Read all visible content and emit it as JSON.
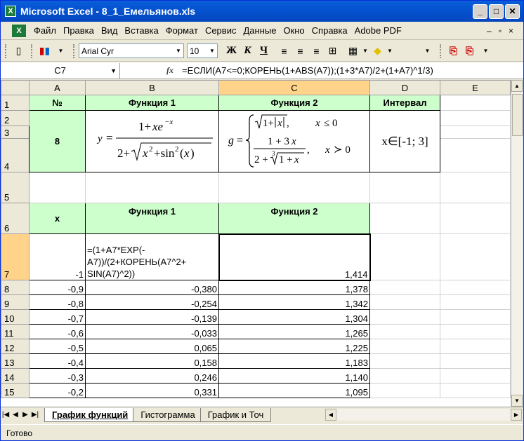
{
  "window": {
    "title": "Microsoft Excel - 8_1_Емельянов.xls",
    "app_icon_text": "X"
  },
  "window_buttons": {
    "minimize": "_",
    "maximize": "□",
    "close": "✕"
  },
  "menu": {
    "items": [
      "Файл",
      "Правка",
      "Вид",
      "Вставка",
      "Формат",
      "Сервис",
      "Данные",
      "Окно",
      "Справка",
      "Adobe PDF"
    ],
    "right": [
      "–",
      "▫",
      "×"
    ]
  },
  "toolbar": {
    "font_name": "Arial Cyr",
    "font_size": "10",
    "bold": "Ж",
    "italic": "К",
    "underline": "Ч"
  },
  "formula_bar": {
    "name_box": "C7",
    "fx": "fx",
    "formula": "=ЕСЛИ(A7<=0;КОРЕНЬ(1+ABS(A7));(1+3*A7)/2+(1+A7)^1/3)"
  },
  "columns": [
    "A",
    "B",
    "C",
    "D",
    "E"
  ],
  "selected_column": "C",
  "selected_row": "7",
  "header_cells": {
    "num": "№",
    "func1": "Функция 1",
    "func2": "Функция 2",
    "interval": "Интервал",
    "variant": "8",
    "interval_value": "x∈[-1; 3]",
    "x_label": "x",
    "func1_b6": "Функция 1",
    "func2_c6": "Функция 2"
  },
  "row7": {
    "a": "-1",
    "b_formula": "=(1+A7*EXP(-A7))/(2+КОРЕНЬ(A7^2+SIN(A7)^2))",
    "b_line1": " =(1+A7*EXP(-",
    "b_line2": "A7))/(2+КОРЕНЬ(A7^2+",
    "b_line3": "SIN(A7)^2))",
    "c": "1,414"
  },
  "rows": [
    {
      "row": "8",
      "a": "-0,9",
      "b": "-0,380",
      "c": "1,378"
    },
    {
      "row": "9",
      "a": "-0,8",
      "b": "-0,254",
      "c": "1,342"
    },
    {
      "row": "10",
      "a": "-0,7",
      "b": "-0,139",
      "c": "1,304"
    },
    {
      "row": "11",
      "a": "-0,6",
      "b": "-0,033",
      "c": "1,265"
    },
    {
      "row": "12",
      "a": "-0,5",
      "b": "0,065",
      "c": "1,225"
    },
    {
      "row": "13",
      "a": "-0,4",
      "b": "0,158",
      "c": "1,183"
    },
    {
      "row": "14",
      "a": "-0,3",
      "b": "0,246",
      "c": "1,140"
    },
    {
      "row": "15",
      "a": "-0,2",
      "b": "0,331",
      "c": "1,095"
    }
  ],
  "row_labels": [
    "1",
    "2",
    "3",
    "4",
    "5",
    "6",
    "7"
  ],
  "sheet_tabs": [
    "График функций",
    "Гистограмма",
    "График и Точ"
  ],
  "active_sheet": "График функций",
  "status": "Готово",
  "colors": {
    "header_green": "#ccffcc",
    "selection": "#ffd38a",
    "title_blue": "#0553d1"
  }
}
